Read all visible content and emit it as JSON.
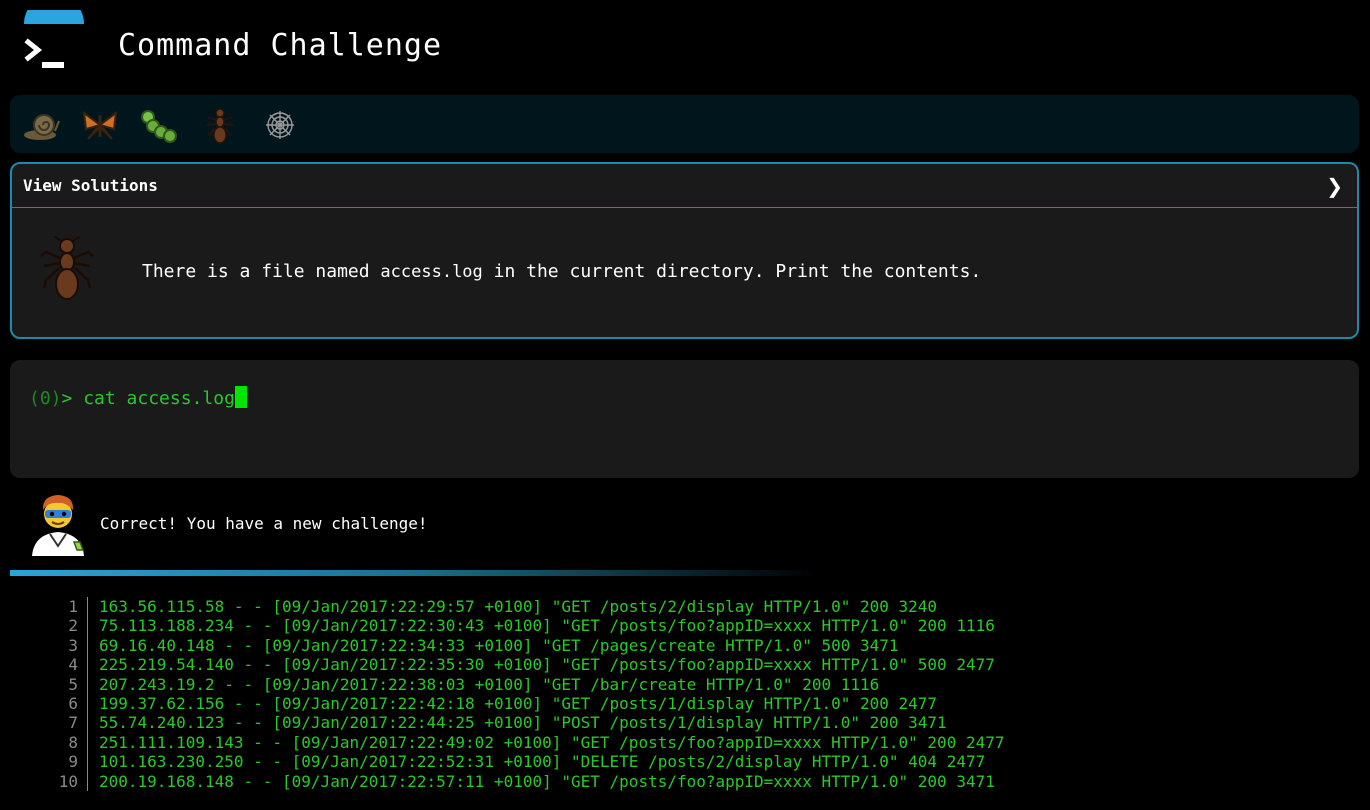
{
  "app": {
    "title": "Command Challenge",
    "logo_icon": "terminal-prompt-icon",
    "accent_color": "#1e8aa8"
  },
  "levels": [
    {
      "name": "snail",
      "icon": "snail-icon"
    },
    {
      "name": "butterfly",
      "icon": "butterfly-icon"
    },
    {
      "name": "caterpillar",
      "icon": "caterpillar-icon"
    },
    {
      "name": "ant",
      "icon": "ant-icon"
    },
    {
      "name": "spider-web",
      "icon": "spider-web-icon"
    }
  ],
  "challenge": {
    "toggle_label": "View Solutions",
    "toggle_icon": "chevron-right-icon",
    "level_icon": "ant-icon",
    "text_before": "There is a file named ",
    "code": "access.log",
    "text_after": " in the current directory. Print the contents."
  },
  "terminal": {
    "count": "(0)",
    "prompt": "> ",
    "command": "cat access.log"
  },
  "feedback": {
    "avatar_icon": "scientist-avatar-icon",
    "message": "Correct! You have a new challenge!"
  },
  "output": {
    "lines": [
      {
        "num": "1",
        "text": "163.56.115.58 - - [09/Jan/2017:22:29:57 +0100] \"GET /posts/2/display HTTP/1.0\" 200 3240"
      },
      {
        "num": "2",
        "text": "75.113.188.234 - - [09/Jan/2017:22:30:43 +0100] \"GET /posts/foo?appID=xxxx HTTP/1.0\" 200 1116"
      },
      {
        "num": "3",
        "text": "69.16.40.148 - - [09/Jan/2017:22:34:33 +0100] \"GET /pages/create HTTP/1.0\" 500 3471"
      },
      {
        "num": "4",
        "text": "225.219.54.140 - - [09/Jan/2017:22:35:30 +0100] \"GET /posts/foo?appID=xxxx HTTP/1.0\" 500 2477"
      },
      {
        "num": "5",
        "text": "207.243.19.2 - - [09/Jan/2017:22:38:03 +0100] \"GET /bar/create HTTP/1.0\" 200 1116"
      },
      {
        "num": "6",
        "text": "199.37.62.156 - - [09/Jan/2017:22:42:18 +0100] \"GET /posts/1/display HTTP/1.0\" 200 2477"
      },
      {
        "num": "7",
        "text": "55.74.240.123 - - [09/Jan/2017:22:44:25 +0100] \"POST /posts/1/display HTTP/1.0\" 200 3471"
      },
      {
        "num": "8",
        "text": "251.111.109.143 - - [09/Jan/2017:22:49:02 +0100] \"GET /posts/foo?appID=xxxx HTTP/1.0\" 200 2477"
      },
      {
        "num": "9",
        "text": "101.163.230.250 - - [09/Jan/2017:22:52:31 +0100] \"DELETE /posts/2/display HTTP/1.0\" 404 2477"
      },
      {
        "num": "10",
        "text": "200.19.168.148 - - [09/Jan/2017:22:57:11 +0100] \"GET /posts/foo?appID=xxxx HTTP/1.0\" 200 3471"
      }
    ]
  }
}
